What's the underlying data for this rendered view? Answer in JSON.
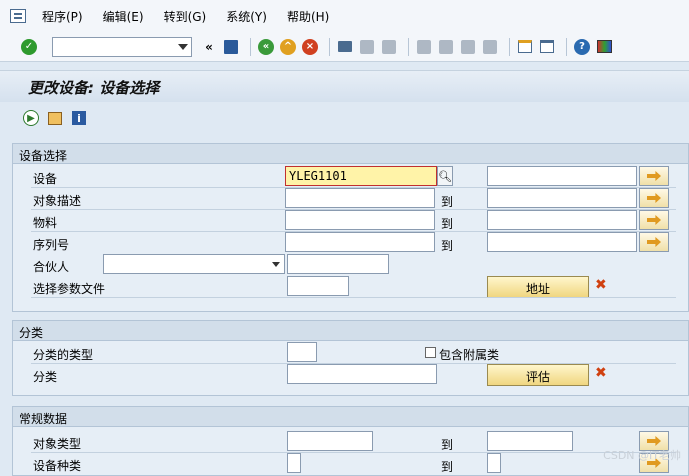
{
  "menu": [
    "程序(P)",
    "编辑(E)",
    "转到(G)",
    "系统(Y)",
    "帮助(H)"
  ],
  "toolbar": {
    "command_value": "",
    "icons": [
      "enter-icon",
      "save-icon",
      "back-icon",
      "exit-icon",
      "cancel-icon",
      "print-icon",
      "find-icon",
      "find-next-icon",
      "first-page-icon",
      "prev-page-icon",
      "next-page-icon",
      "last-page-icon",
      "new-session-icon",
      "shortcut-icon",
      "help-icon",
      "layout-icon"
    ]
  },
  "title": "更改设备: 设备选择",
  "sections": {
    "equipment": {
      "title": "设备选择",
      "labels": {
        "equipment": "设备",
        "description": "对象描述",
        "material": "物料",
        "serial": "序列号",
        "partner": "合伙人",
        "profile": "选择参数文件"
      },
      "to": "到",
      "equipment_value": "YLEG1101",
      "address_button": "地址"
    },
    "classification": {
      "title": "分类",
      "labels": {
        "class_type": "分类的类型",
        "class": "分类"
      },
      "include_subclasses": "包含附属类",
      "evaluate_button": "评估"
    },
    "general": {
      "title": "常规数据",
      "labels": {
        "object_type": "对象类型",
        "equipment_category": "设备种类"
      },
      "to": "到"
    }
  },
  "watermark": "CSDN @IT老帅"
}
